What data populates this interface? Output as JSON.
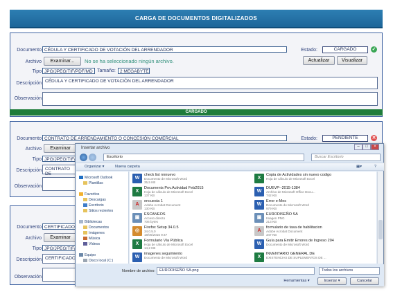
{
  "header": {
    "title": "CARGA DE DOCUMENTOS DIGITALIZADOS"
  },
  "labels": {
    "documento": "Documento",
    "archivo": "Archivo",
    "tipo": "Tipo",
    "tamano": "Tamaño:",
    "descripcion": "Descripción",
    "observacion": "Observación",
    "estado": "Estado:"
  },
  "buttons": {
    "examinar": "Examinar...",
    "actualizar": "Actualizar",
    "visualizar": "Visualizar"
  },
  "forms": [
    {
      "documento": "CÉDULA Y CERTIFICADO DE VOTACIÓN DEL ARRENDADOR",
      "archivo_note": "No se ha seleccionado ningún archivo.",
      "tipo": "JPG/JPEG/TIF/PDF/MD",
      "tamano": "2 MEGABYTES",
      "descripcion": "CÉDULA Y CERTIFICADO DE VOTACIÓN DEL ARRENDADOR",
      "estado": "CARGADO",
      "estado_color": "#3aa655",
      "status_bar": "CARGADO"
    },
    {
      "documento": "CONTRATO DE ARRENDAMIENTO O CONCESIÓN COMERCIAL",
      "tipo": "JPG/JPEG/TIF/F",
      "descripcion": "CONTRATO DE",
      "estado": "PENDIENTE",
      "estado_color": "#e05050",
      "examinar_short": "Examinar"
    },
    {
      "documento": "CERTIFICADO",
      "tipo": "JPG/JPEG/TIF/F",
      "descripcion": "CERTIFICADO"
    }
  ],
  "dialog": {
    "title": "Insertar archivo",
    "address": "Escritorio",
    "search_placeholder": "Buscar Escritorio",
    "toolbar": {
      "organize": "Organizar ▾",
      "new_folder": "Nueva carpeta"
    },
    "nav": [
      {
        "label": "Microsoft Outlook",
        "icon": "outlook-icon"
      },
      {
        "label": "Plantillas",
        "icon": "folder-icon"
      },
      {
        "label": "Favoritos",
        "icon": "star-icon"
      },
      {
        "label": "Descargas",
        "icon": "folder-icon"
      },
      {
        "label": "Escritorio",
        "icon": "desktop-icon"
      },
      {
        "label": "Sitios recientes",
        "icon": "folder-icon"
      },
      {
        "label": "Bibliotecas",
        "icon": "library-icon"
      },
      {
        "label": "Documentos",
        "icon": "folder-icon"
      },
      {
        "label": "Imágenes",
        "icon": "folder-icon"
      },
      {
        "label": "Música",
        "icon": "music-icon"
      },
      {
        "label": "Vídeos",
        "icon": "video-icon"
      },
      {
        "label": "Equipo",
        "icon": "computer-icon"
      },
      {
        "label": "Disco local (C:)",
        "icon": "drive-icon"
      },
      {
        "label": "Nuevo vol (D:)",
        "icon": "drive-icon"
      }
    ],
    "files_left": [
      {
        "name": "check list nnnuevo",
        "type": "Documento de Microsoft Word",
        "size": "35,5 KB",
        "icon": "word"
      },
      {
        "name": "Documents Pov.Actividad Feb2015",
        "type": "Hoja de cálculo de Microsoft Excel",
        "size": "137 KB",
        "icon": "excel"
      },
      {
        "name": "encuesta 1",
        "type": "Adobe Acrobat Document",
        "size": "130 KB",
        "icon": "pdf"
      },
      {
        "name": "ESCANEOS",
        "type": "Acceso directo",
        "size": "706 bytes",
        "icon": "img"
      },
      {
        "name": "Firefox Setup 34.0.5",
        "type": "34.0.5.0",
        "size": "18/05/2015 9:47",
        "icon": "exe"
      },
      {
        "name": "Formulario Vía Pública",
        "type": "Hoja de cálculo de Microsoft Excel",
        "size": "14,2 KB",
        "icon": "excel"
      },
      {
        "name": "imagenes seguimiento",
        "type": "Documento de Microsoft Word",
        "size": "",
        "icon": "word"
      }
    ],
    "files_right": [
      {
        "name": "Copia de Actividades sin nuevo codigo",
        "type": "Hoja de cálculo de Microsoft Excel",
        "size": "",
        "icon": "excel"
      },
      {
        "name": "DUEVP--2015-1384",
        "type": "Archivo de Microsoft Office Docu...",
        "size": "742 KB",
        "icon": "word"
      },
      {
        "name": "Error e-Mes",
        "type": "Documento de Microsoft Word",
        "size": "979 KB",
        "icon": "word"
      },
      {
        "name": "EURODISEÑO SA",
        "type": "Imagen PNG",
        "size": "213 KB",
        "icon": "img"
      },
      {
        "name": "formulario de tasa de habilitacion",
        "type": "Adobe Acrobat Document",
        "size": "347 KB",
        "icon": "pdf"
      },
      {
        "name": "Guía para Emitir Errores de Ingreso 204",
        "type": "Documento de Microsoft Word",
        "size": "",
        "icon": "word"
      },
      {
        "name": "INVENTARIO GENERAL DE",
        "type": "EXISTENCIAS DE SUPLEMENTOS DE ...",
        "size": "",
        "icon": "excel"
      }
    ],
    "filename_label": "Nombre de archivo:",
    "filename": "EURODISEÑO SA.png",
    "filter": "Todos los archivos",
    "tools": "Herramientas ▾",
    "insert": "Insertar ▾",
    "cancel": "Cancelar"
  }
}
